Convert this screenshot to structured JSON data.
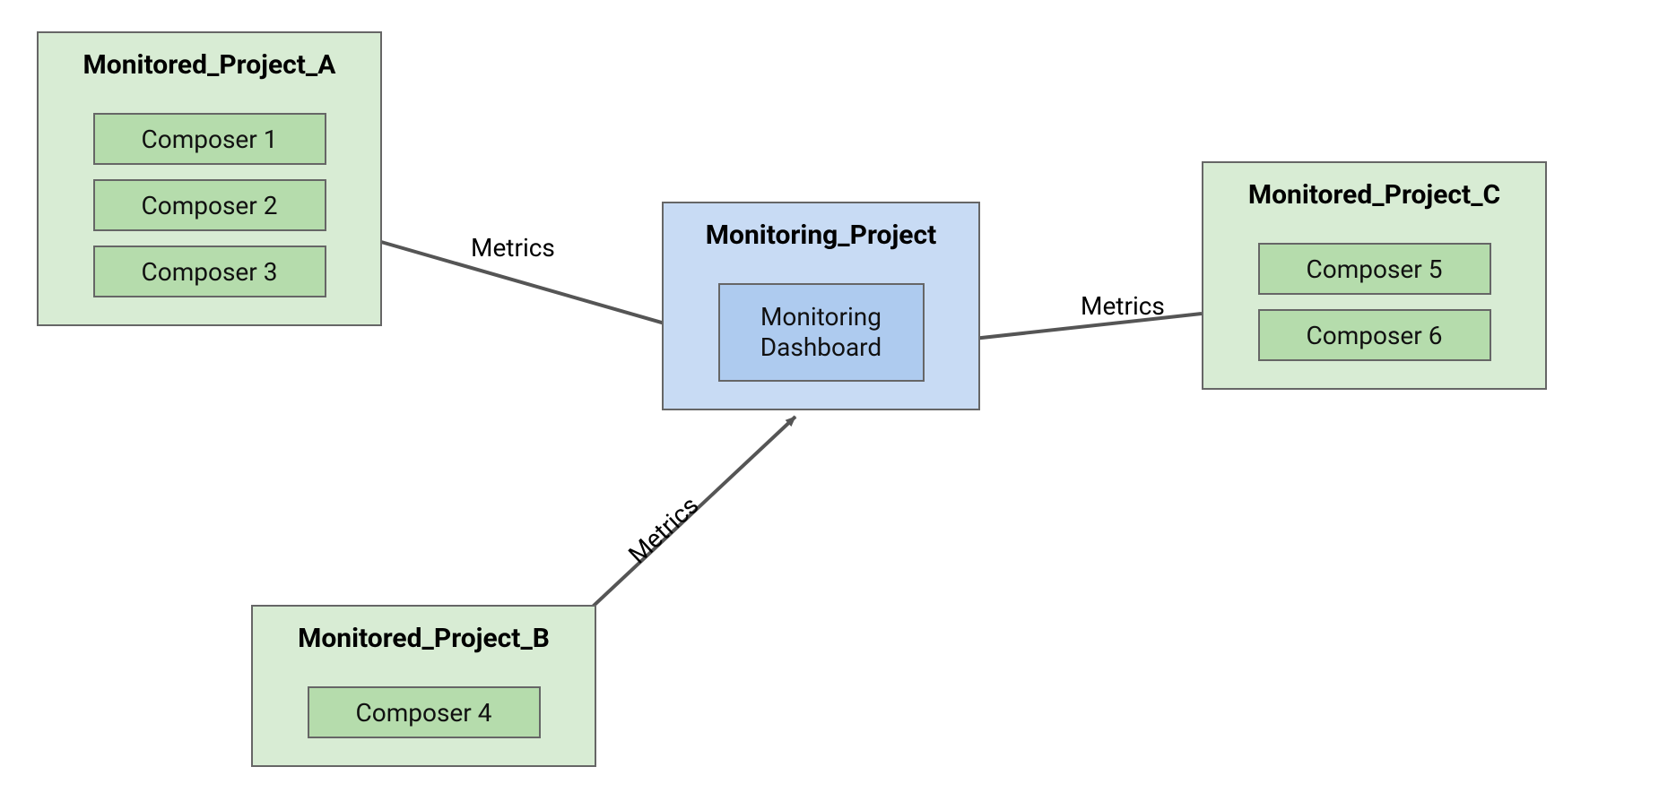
{
  "projectA": {
    "title": "Monitored_Project_A",
    "items": [
      "Composer 1",
      "Composer 2",
      "Composer 3"
    ]
  },
  "projectB": {
    "title": "Monitored_Project_B",
    "items": [
      "Composer 4"
    ]
  },
  "projectC": {
    "title": "Monitored_Project_C",
    "items": [
      "Composer 5",
      "Composer 6"
    ]
  },
  "monitoring": {
    "title": "Monitoring_Project",
    "dashboard_line1": "Monitoring",
    "dashboard_line2": "Dashboard"
  },
  "edges": {
    "a": "Metrics",
    "b": "Metrics",
    "c": "Metrics"
  }
}
